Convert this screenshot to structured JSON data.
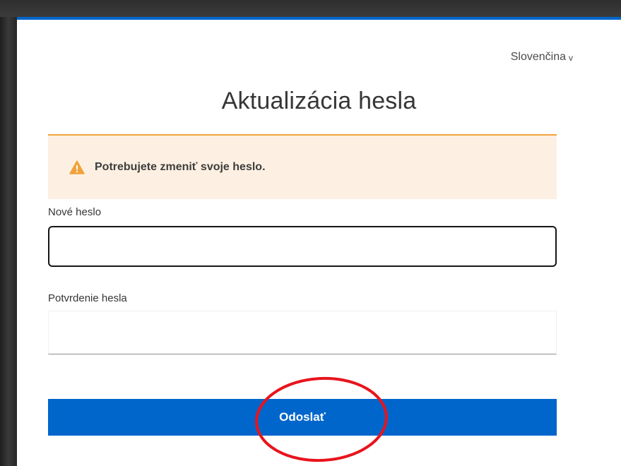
{
  "locale": {
    "label": "Slovenčina",
    "chevron": "v"
  },
  "page": {
    "title": "Aktualizácia hesla"
  },
  "alert": {
    "icon": "warning-triangle-icon",
    "message": "Potrebujete zmeniť svoje heslo.",
    "bg_color": "#fdf0e2",
    "accent_color": "#f0a33a"
  },
  "form": {
    "new_password_label": "Nové heslo",
    "new_password_value": "",
    "confirm_password_label": "Potvrdenie hesla",
    "confirm_password_value": "",
    "submit_label": "Odoslať"
  },
  "colors": {
    "primary": "#0066cc",
    "annotation": "#e8141c"
  }
}
